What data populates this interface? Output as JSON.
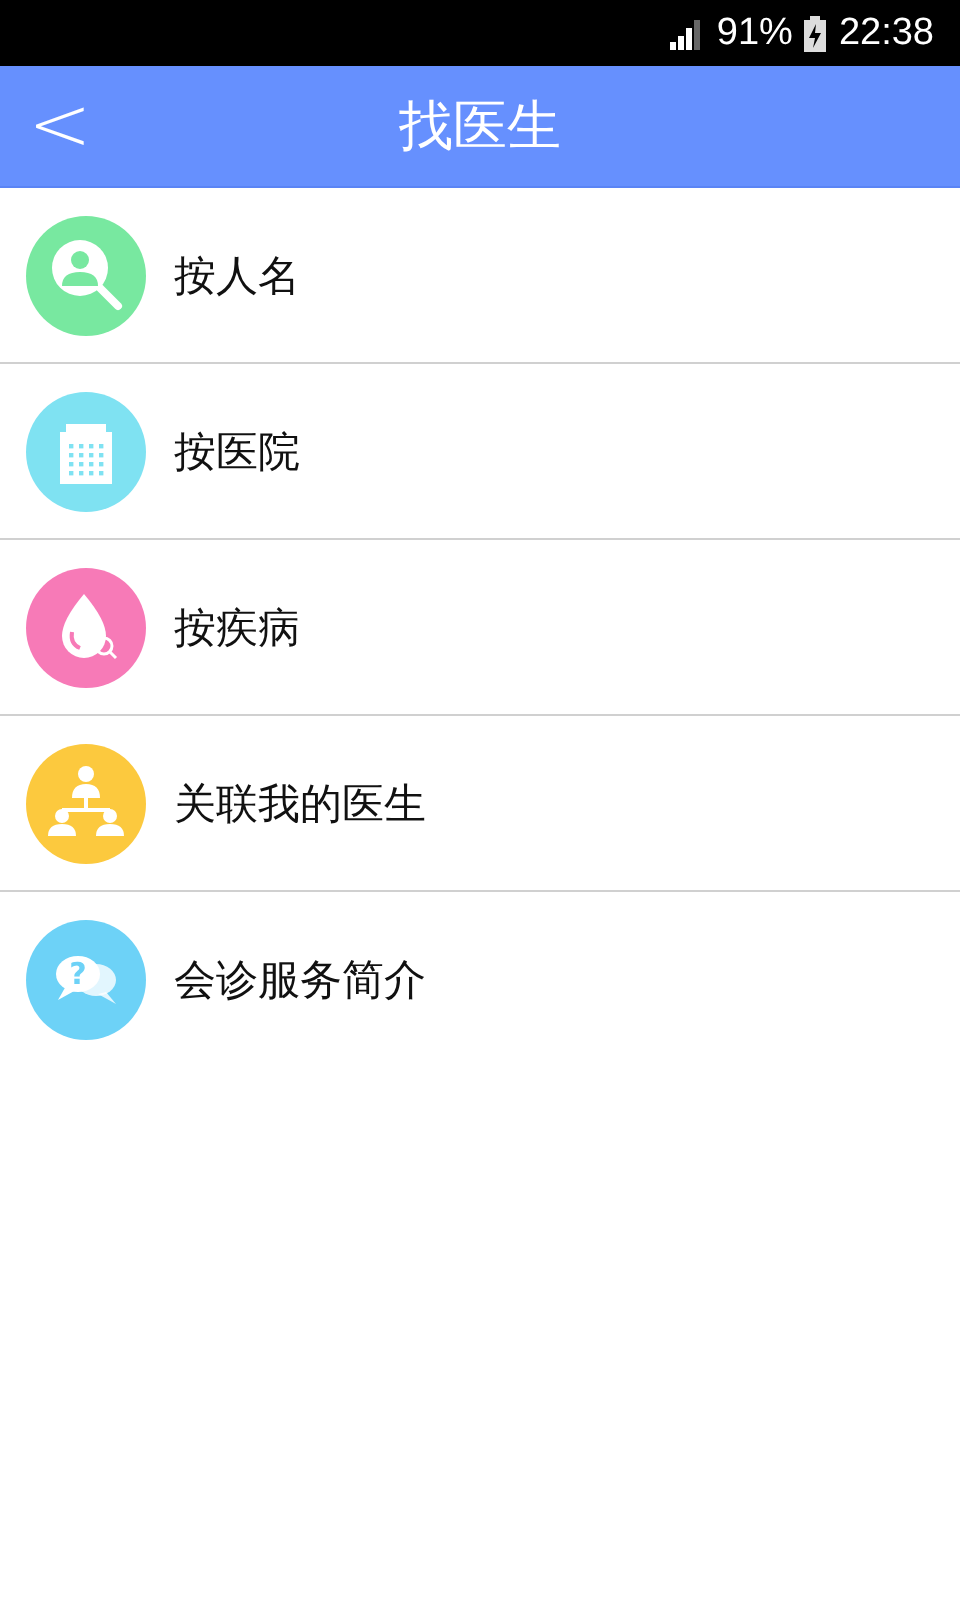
{
  "status_bar": {
    "battery": "91%",
    "time": "22:38"
  },
  "header": {
    "back": "<",
    "title": "找医生"
  },
  "items": [
    {
      "label": "按人名",
      "kind": "search",
      "color": "#78e8a0"
    },
    {
      "label": "按医院",
      "kind": "hospital",
      "color": "#7fe2f2"
    },
    {
      "label": "按疾病",
      "kind": "drop",
      "color": "#f77ab7"
    },
    {
      "label": "关联我的医生",
      "kind": "network",
      "color": "#fcc93e"
    },
    {
      "label": "会诊服务简介",
      "kind": "chat",
      "color": "#6dd2f7",
      "glyph": "?"
    }
  ]
}
